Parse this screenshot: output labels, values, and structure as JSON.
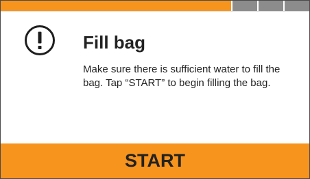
{
  "progress": {
    "completed_fraction": 0.75,
    "remaining_steps": 3,
    "colors": {
      "done": "#f7941d",
      "todo": "#8c8c8c"
    }
  },
  "dialog": {
    "icon": "exclamation-circle-icon",
    "title": "Fill bag",
    "message": "Make sure there is sufficient water to fill the bag. Tap “START” to begin filling the bag."
  },
  "actions": {
    "start_label": "START",
    "accent_color": "#f7941d"
  }
}
